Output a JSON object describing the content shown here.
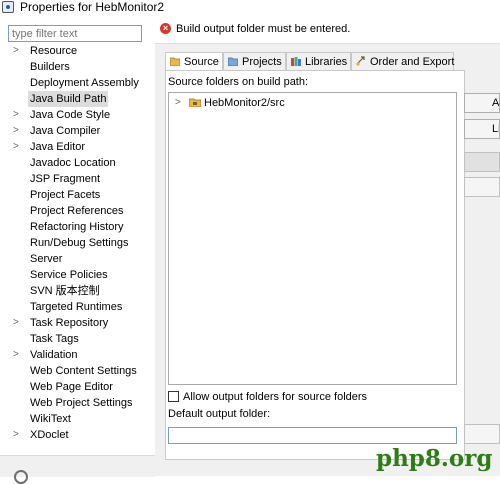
{
  "window": {
    "title": "Properties for HebMonitor2"
  },
  "filter": {
    "placeholder": "type filter text"
  },
  "tree": {
    "items": [
      {
        "label": "Resource",
        "expandable": true
      },
      {
        "label": "Builders",
        "expandable": false
      },
      {
        "label": "Deployment Assembly",
        "expandable": false
      },
      {
        "label": "Java Build Path",
        "expandable": false,
        "selected": true
      },
      {
        "label": "Java Code Style",
        "expandable": true
      },
      {
        "label": "Java Compiler",
        "expandable": true
      },
      {
        "label": "Java Editor",
        "expandable": true
      },
      {
        "label": "Javadoc Location",
        "expandable": false
      },
      {
        "label": "JSP Fragment",
        "expandable": false
      },
      {
        "label": "Project Facets",
        "expandable": false
      },
      {
        "label": "Project References",
        "expandable": false
      },
      {
        "label": "Refactoring History",
        "expandable": false
      },
      {
        "label": "Run/Debug Settings",
        "expandable": false
      },
      {
        "label": "Server",
        "expandable": false
      },
      {
        "label": "Service Policies",
        "expandable": false
      },
      {
        "label": "SVN 版本控制",
        "expandable": false
      },
      {
        "label": "Targeted Runtimes",
        "expandable": false
      },
      {
        "label": "Task Repository",
        "expandable": true
      },
      {
        "label": "Task Tags",
        "expandable": false
      },
      {
        "label": "Validation",
        "expandable": true
      },
      {
        "label": "Web Content Settings",
        "expandable": false
      },
      {
        "label": "Web Page Editor",
        "expandable": false
      },
      {
        "label": "Web Project Settings",
        "expandable": false
      },
      {
        "label": "WikiText",
        "expandable": false
      },
      {
        "label": "XDoclet",
        "expandable": true
      }
    ]
  },
  "message": {
    "text": "Build output folder must be entered.",
    "icon": "error-icon"
  },
  "tabs": [
    {
      "label": "Source",
      "icon": "source-folder-icon",
      "active": true
    },
    {
      "label": "Projects",
      "icon": "projects-icon",
      "active": false
    },
    {
      "label": "Libraries",
      "icon": "libraries-icon",
      "active": false
    },
    {
      "label": "Order and Export",
      "icon": "order-export-icon",
      "active": false
    }
  ],
  "source": {
    "folders_label": "Source folders on build path:",
    "folders": [
      {
        "label": "HebMonitor2/src"
      }
    ],
    "allow_output_label": "Allow output folders for source folders",
    "allow_output_checked": false,
    "default_output_label": "Default output folder:",
    "default_output_value": ""
  },
  "buttons": {
    "add": "Add Folder...",
    "link": "Link Source..."
  },
  "watermark": {
    "text": "php8.org"
  },
  "colors": {
    "error": "#d9362b",
    "selection": "#dcdcdc",
    "watermark": "#2d7d14"
  }
}
